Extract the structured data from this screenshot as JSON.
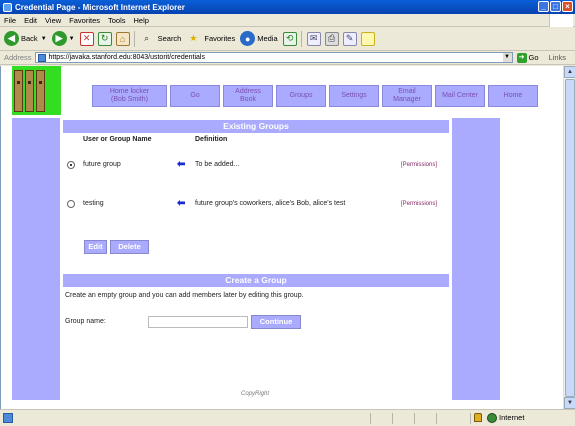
{
  "window": {
    "title": "Credential Page - Microsoft Internet Explorer"
  },
  "menu": [
    "File",
    "Edit",
    "View",
    "Favorites",
    "Tools",
    "Help"
  ],
  "toolbar": {
    "back": "Back",
    "search": "Search",
    "favorites": "Favorites",
    "media": "Media"
  },
  "address": {
    "label": "Address",
    "url": "https://javaka.stanford.edu:8043/ustorit/credentials",
    "go": "Go",
    "links": "Links"
  },
  "nav": [
    {
      "label": "Home locker\n(Bob Smith)"
    },
    {
      "label": "Go"
    },
    {
      "label": "Address\nBook"
    },
    {
      "label": "Groups"
    },
    {
      "label": "Settings"
    },
    {
      "label": "Email\nManager"
    },
    {
      "label": "Mail Center"
    },
    {
      "label": "Home"
    }
  ],
  "existing": {
    "header": "Existing Groups",
    "col_name": "User or Group Name",
    "col_def": "Definition",
    "rows": [
      {
        "name": "future group",
        "definition": "To be added...",
        "permissions": "[Permissions]",
        "selected": true
      },
      {
        "name": "testing",
        "definition": "future group's coworkers, alice's Bob, alice's test",
        "permissions": "[Permissions]",
        "selected": false
      }
    ],
    "edit_label": "Edit",
    "delete_label": "Delete"
  },
  "create": {
    "header": "Create a Group",
    "description": "Create an empty group and you can add members later by editing this group.",
    "name_label": "Group name:",
    "name_value": "",
    "continue_label": "Continue"
  },
  "footer": {
    "copyright": "CopyRight"
  },
  "status": {
    "zone": "Internet"
  },
  "colors": {
    "accent": "#aaaaff",
    "nav_text": "#7a50b0",
    "perm_link": "#8a2a6a"
  }
}
